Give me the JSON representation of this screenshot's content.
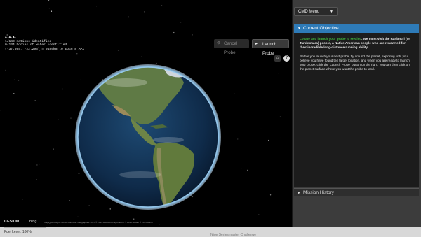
{
  "hud": {
    "lines": [
      "▲.▲.▲.",
      "1/143 nations identified",
      "0/134 bodies of water identified",
      "(-37.505, -22.295) = 9489km to EDGN 8 APX"
    ]
  },
  "viewer": {
    "cancel_label": "Cancel Probe",
    "launch_label": "Launch Probe",
    "home_icon": "⌂",
    "help_icon": "?",
    "cesium_label": "CESIUM",
    "bing_label": "bing",
    "credits": "Image courtesy of NASA • Earthstar Geographics SIO • © 2015 Microsoft Corporation • © 2015 Nokia • © 2015 Harris"
  },
  "panel": {
    "cmd_menu": "CMD Menu",
    "current_objective": "Current Objective",
    "mission_history": "Mission History",
    "objective_p1": {
      "highlight": "Locate and launch your probe to",
      "location": "Mexico",
      "rest": ". We must visit the Rarámuri (or Tarahumara) people, a Native American people who are renowned for their incredible long-distance running ability."
    },
    "objective_p2": "Before you launch your next probe, fly around the planet, exploring until you believe you have found the target location, and when you are ready to launch your probe, click the 'Launch Probe' button on the right. You can then click on the planet surface where you want the probe to land."
  },
  "status": {
    "fuel": "Fuel Level: 100%",
    "center": "Nine Seriesmaster Challenge"
  },
  "colors": {
    "accent": "#2e7bb8",
    "highlight_green": "#3fb63f",
    "panel_bg": "#3c3c3c"
  }
}
